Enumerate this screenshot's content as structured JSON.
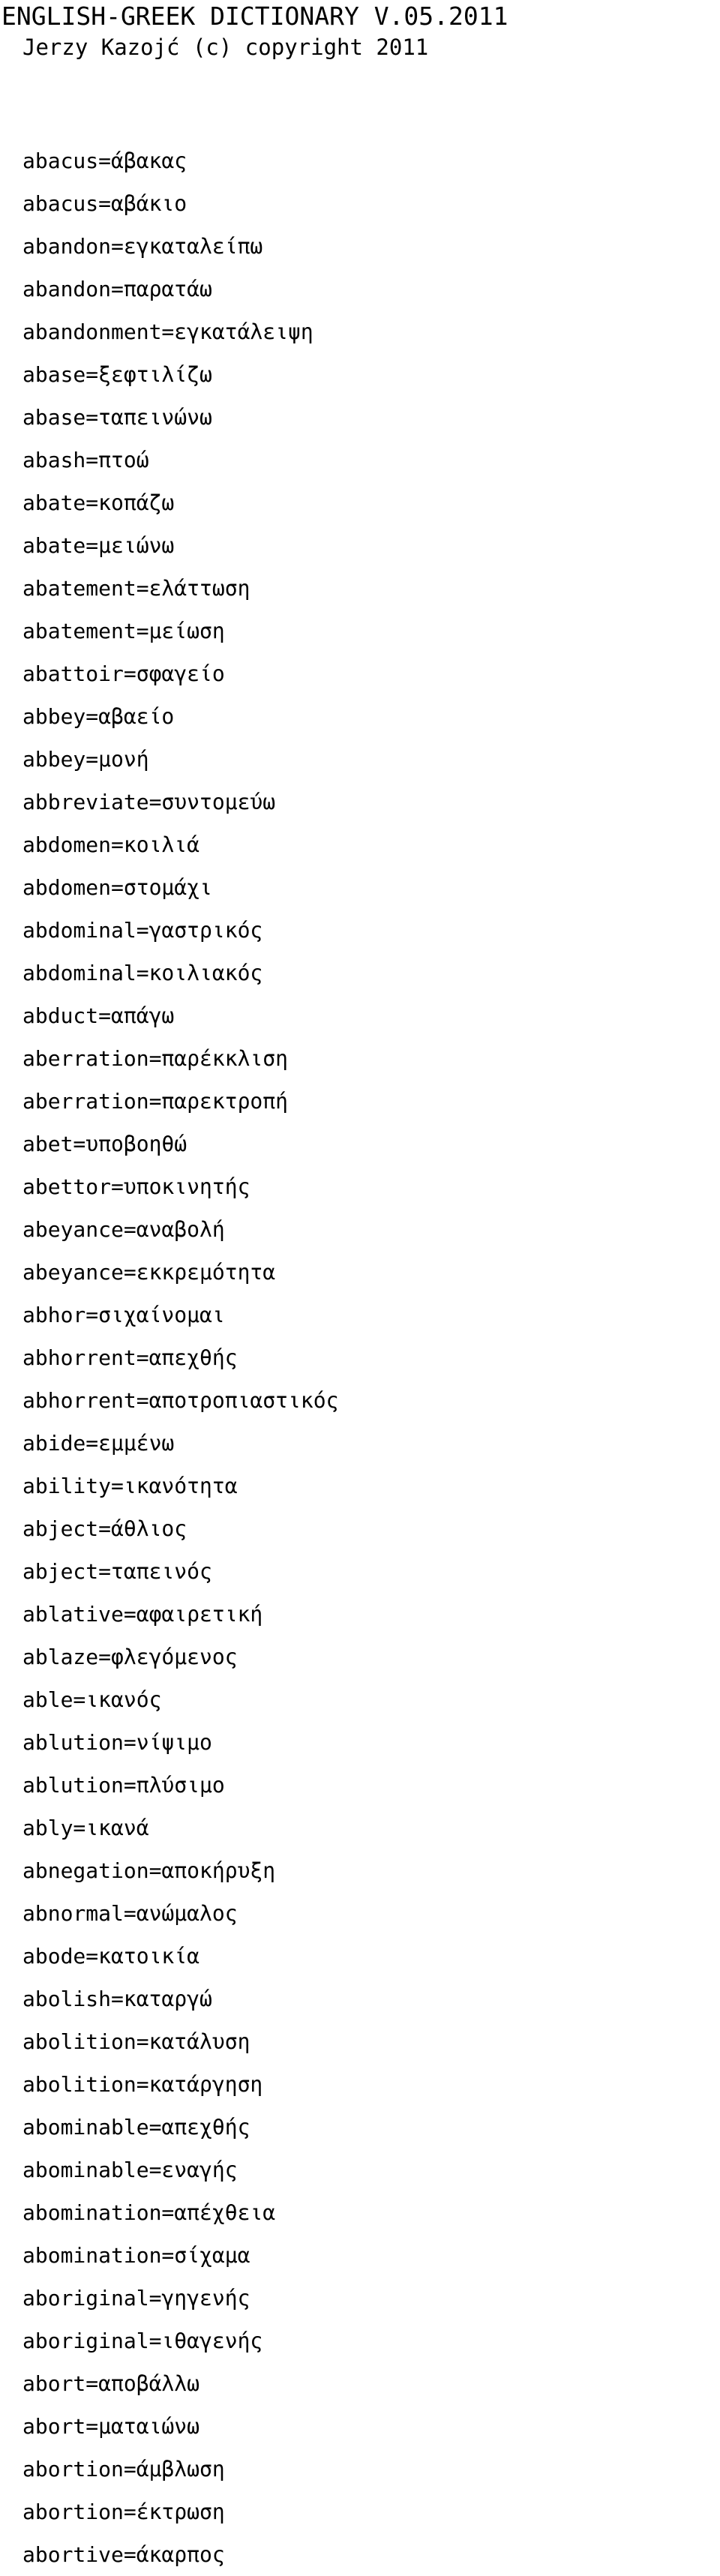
{
  "document": {
    "title": "ENGLISH-GREEK DICTIONARY V.05.2011",
    "byline": "Jerzy Kazojć (c) copyright 2011"
  },
  "entries": [
    "abacus=άβακας",
    "abacus=αβάκιο",
    "abandon=εγκαταλείπω",
    "abandon=παρατάω",
    "abandonment=εγκατάλειψη",
    "abase=ξεφτιλίζω",
    "abase=ταπεινώνω",
    "abash=πτοώ",
    "abate=κοπάζω",
    "abate=μειώνω",
    "abatement=ελάττωση",
    "abatement=μείωση",
    "abattoir=σφαγείο",
    "abbey=αβαείο",
    "abbey=μονή",
    "abbreviate=συντομεύω",
    "abdomen=κοιλιά",
    "abdomen=στομάχι",
    "abdominal=γαστρικός",
    "abdominal=κοιλιακός",
    "abduct=απάγω",
    "aberration=παρέκκλιση",
    "aberration=παρεκτροπή",
    "abet=υποβοηθώ",
    "abettor=υποκινητής",
    "abeyance=αναβολή",
    "abeyance=εκκρεμότητα",
    "abhor=σιχαίνομαι",
    "abhorrent=απεχθής",
    "abhorrent=αποτροπιαστικός",
    "abide=εμμένω",
    "ability=ικανότητα",
    "abject=άθλιος",
    "abject=ταπεινός",
    "ablative=αφαιρετική",
    "ablaze=φλεγόμενος",
    "able=ικανός",
    "ablution=νίψιμο",
    "ablution=πλύσιμο",
    "ably=ικανά",
    "abnegation=αποκήρυξη",
    "abnormal=ανώμαλος",
    "abode=κατοικία",
    "abolish=καταργώ",
    "abolition=κατάλυση",
    "abolition=κατάργηση",
    "abominable=απεχθής",
    "abominable=εναγής",
    "abomination=απέχθεια",
    "abomination=σίχαμα",
    "aboriginal=γηγενής",
    "aboriginal=ιθαγενής",
    "abort=αποβάλλω",
    "abort=ματαιώνω",
    "abortion=άμβλωση",
    "abortion=έκτρωση",
    "abortive=άκαρπος"
  ]
}
